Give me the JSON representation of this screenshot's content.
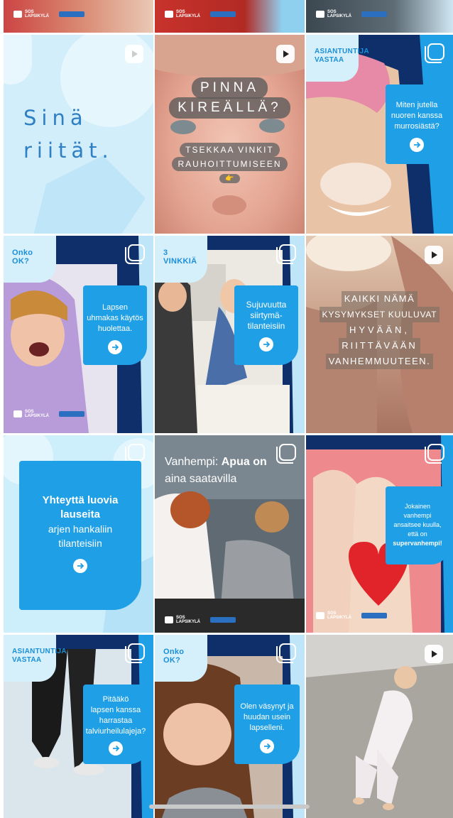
{
  "tiles": {
    "t1": {
      "line1": "Sinä",
      "line2": "riität.",
      "type_icon": "reel-icon"
    },
    "t2": {
      "line1": "PINNA",
      "line2": "KIREÄLLÄ?",
      "sub1": "TSEKKAA VINKIT",
      "sub2": "RAUHOITTUMISEEN",
      "emoji": "👉",
      "type_icon": "reel-icon"
    },
    "t3": {
      "tag1": "ASIANTUNTIJA",
      "tag2": "VASTAA",
      "card": [
        "Miten jutella",
        "nuoren kanssa",
        "murrosiästä?"
      ],
      "type_icon": "carousel-icon"
    },
    "t4": {
      "tag1": "Onko",
      "tag2": "OK?",
      "card": [
        "Lapsen",
        "uhmakas käytös",
        "huolettaa."
      ],
      "type_icon": "carousel-icon"
    },
    "t5": {
      "tag1": "3",
      "tag2": "VINKKIÄ",
      "card": [
        "Sujuvuutta",
        "siirtymä-",
        "tilanteisiin"
      ],
      "type_icon": "carousel-icon"
    },
    "t6": {
      "lines": [
        "KAIKKI NÄMÄ",
        "KYSYMYKSET KUULUVAT",
        "HYVÄÄN,",
        "RIITTÄVÄÄN",
        "VANHEMMUUTEEN."
      ],
      "type_icon": "reel-icon"
    },
    "t7": {
      "bold1": "Yhteyttä luovia",
      "bold2": "lauseita",
      "reg1": "arjen hankaliin",
      "reg2": "tilanteisiin",
      "type_icon": "carousel-icon"
    },
    "t8": {
      "plain": "Vanhempi: ",
      "bold": "Apua on",
      "line2": "aina saatavilla",
      "type_icon": "carousel-icon"
    },
    "t9": {
      "card": [
        "Jokainen",
        "vanhempi",
        "ansaitsee kuulla,",
        "että on"
      ],
      "card_bold": "supervanhempi!",
      "type_icon": "carousel-icon"
    },
    "t10": {
      "tag1": "ASIANTUNTIJA",
      "tag2": "VASTAA",
      "card": [
        "Pitääkö",
        "lapsen kanssa",
        "harrastaa",
        "talviurheilulajeja?"
      ],
      "type_icon": "carousel-icon"
    },
    "t11": {
      "tag1": "Onko",
      "tag2": "OK?",
      "card": [
        "Olen väsynyt ja",
        "huudan usein",
        "lapselleni."
      ],
      "type_icon": "carousel-icon"
    },
    "t12": {
      "type_icon": "reel-icon"
    }
  },
  "logo": {
    "line1": "SOS",
    "line2": "LAPSIKYLÄ"
  },
  "colors": {
    "brand_blue": "#1e9fe6",
    "navy": "#0f2f6b",
    "light_blue": "#d6f0fb"
  }
}
